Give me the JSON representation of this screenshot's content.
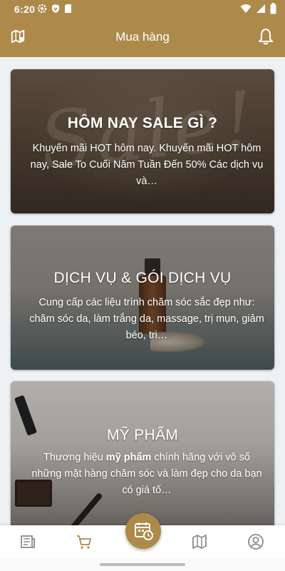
{
  "status_bar": {
    "time": "6:20",
    "icons": [
      "gear-icon",
      "shield-icon",
      "sd-card-icon",
      "wifi-icon",
      "signal-icon",
      "battery-icon"
    ]
  },
  "header": {
    "title": "Mua hàng",
    "left_icon": "map-pin-icon",
    "right_icon": "bell-icon"
  },
  "cards": [
    {
      "title": "HÔM NAY SALE GÌ ?",
      "description": "Khuyến mãi HOT hôm nay. Khuyến mãi HOT hôm nay, Sale To Cuối Năm Tuần Đến 50% Các dịch vụ và…",
      "background_word": "Sale!"
    },
    {
      "title": "DỊCH VỤ & GÓI DỊCH VỤ",
      "description": "Cung cấp các liệu trình chăm sóc sắc đẹp như: chăm sóc da, làm trắng da, massage, trị mụn, giảm béo, tri…"
    },
    {
      "title": "MỸ PHẨM",
      "description_before": "Thương hiệu ",
      "description_bold": "mỹ phẩm",
      "description_after": " chính hãng với vô số những mặt hàng chăm sóc và làm đẹp cho da bạn có giá tố…"
    }
  ],
  "bottom_nav": {
    "items": [
      "news-icon",
      "cart-icon",
      "calendar-clock-icon",
      "map-icon",
      "profile-icon"
    ],
    "active": "cart-icon"
  },
  "colors": {
    "primary": "#ad8a4a",
    "background": "#eef1f4",
    "nav_inactive": "#8a8a8a"
  }
}
